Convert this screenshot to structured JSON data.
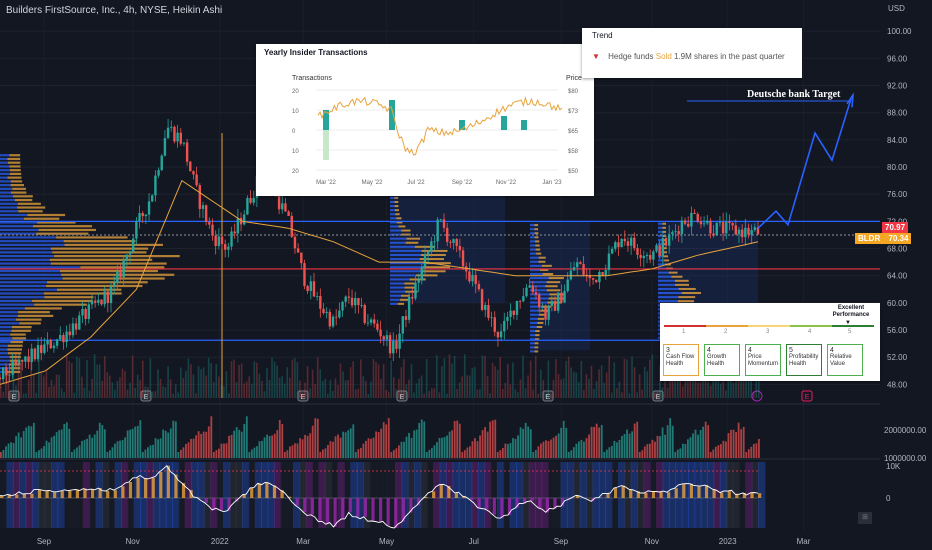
{
  "header": {
    "title": "Builders FirstSource, Inc., 4h, NYSE, Heikin Ashi"
  },
  "annotation": {
    "target_label": "Deutsche bank Target"
  },
  "price_tags": [
    {
      "ticker": "",
      "value": "70.97",
      "color": "#f23645"
    },
    {
      "ticker": "BLDR",
      "value": "70.34",
      "color": "#f5a623"
    }
  ],
  "icons": {
    "tv_logo": "tradingview-logo-icon",
    "earnings": "earnings-e-icon",
    "dividend": "dividend-icon"
  },
  "insider_panel": {
    "title": "Yearly Insider Transactions",
    "left_label": "Transactions",
    "right_label": "Price",
    "left_ticks": [
      "20",
      "10",
      "0",
      "10",
      "20"
    ],
    "right_ticks": [
      "$80",
      "$73",
      "$65",
      "$58",
      "$50"
    ],
    "x_ticks": [
      "Mar '22",
      "May '22",
      "Jul '22",
      "Sep '22",
      "Nov '22",
      "Jan '23"
    ]
  },
  "trend_panel": {
    "title": "Trend",
    "text_prefix": "Hedge funds ",
    "text_sold": "Sold",
    "text_suffix": " 1.9M shares in the past quarter"
  },
  "performance_panel": {
    "title": "Excellent Performance",
    "scale": [
      "1",
      "2",
      "3",
      "4",
      "5"
    ],
    "cards": [
      {
        "score": "3",
        "label": "Cash Flow Health"
      },
      {
        "score": "4",
        "label": "Growth Health"
      },
      {
        "score": "4",
        "label": "Price Momentum"
      },
      {
        "score": "5",
        "label": "Profitability Health"
      },
      {
        "score": "4",
        "label": "Relative Value"
      }
    ]
  },
  "chart_data": {
    "type": "candlestick",
    "title": "Builders FirstSource, Inc., 4h, NYSE, Heikin Ashi",
    "price_axis": {
      "unit": "USD",
      "ticks": [
        100,
        96,
        92,
        88,
        84,
        80,
        76,
        72,
        68,
        64,
        60,
        56,
        52,
        48
      ],
      "range": [
        46,
        104
      ]
    },
    "volume_axis": {
      "ticks": [
        "2000000.00",
        "1000000.00"
      ]
    },
    "osc_axis": {
      "ticks": [
        "10K",
        "0"
      ]
    },
    "x_ticks": [
      "Sep",
      "Nov",
      "2022",
      "Mar",
      "May",
      "Jul",
      "Sep",
      "Nov",
      "2023",
      "Mar"
    ],
    "horizontal_levels": [
      {
        "price": 72.0,
        "color": "#2962ff"
      },
      {
        "price": 70.0,
        "color": "#787b86"
      },
      {
        "price": 65.0,
        "color": "#f23645"
      },
      {
        "price": 54.5,
        "color": "#2962ff"
      }
    ],
    "projection": [
      71,
      73.5,
      71.5,
      85,
      81,
      90.5
    ],
    "target_price": 90.5,
    "last_price": 70.34,
    "high_price": 70.97,
    "price_path": [
      [
        0,
        49
      ],
      [
        0.04,
        52
      ],
      [
        0.08,
        55
      ],
      [
        0.12,
        59
      ],
      [
        0.15,
        62
      ],
      [
        0.18,
        71
      ],
      [
        0.2,
        76
      ],
      [
        0.22,
        86
      ],
      [
        0.24,
        84
      ],
      [
        0.26,
        76
      ],
      [
        0.28,
        70
      ],
      [
        0.3,
        68
      ],
      [
        0.32,
        73
      ],
      [
        0.34,
        78
      ],
      [
        0.36,
        77
      ],
      [
        0.38,
        72
      ],
      [
        0.4,
        64
      ],
      [
        0.42,
        60
      ],
      [
        0.44,
        57
      ],
      [
        0.46,
        61
      ],
      [
        0.48,
        58
      ],
      [
        0.5,
        56
      ],
      [
        0.52,
        53
      ],
      [
        0.54,
        60
      ],
      [
        0.56,
        66
      ],
      [
        0.58,
        72
      ],
      [
        0.6,
        68
      ],
      [
        0.62,
        64
      ],
      [
        0.64,
        59
      ],
      [
        0.66,
        55
      ],
      [
        0.68,
        60
      ],
      [
        0.7,
        63
      ],
      [
        0.72,
        58
      ],
      [
        0.74,
        61
      ],
      [
        0.76,
        66
      ],
      [
        0.78,
        63
      ],
      [
        0.8,
        66
      ],
      [
        0.82,
        70
      ],
      [
        0.84,
        68
      ],
      [
        0.86,
        67
      ],
      [
        0.88,
        69
      ],
      [
        0.9,
        72
      ],
      [
        0.92,
        73
      ],
      [
        0.94,
        71
      ],
      [
        1,
        70.34
      ]
    ],
    "ma_path": [
      [
        0,
        48
      ],
      [
        0.06,
        50
      ],
      [
        0.12,
        55
      ],
      [
        0.18,
        62
      ],
      [
        0.24,
        78
      ],
      [
        0.28,
        75
      ],
      [
        0.32,
        72
      ],
      [
        0.38,
        71
      ],
      [
        0.44,
        69
      ],
      [
        0.5,
        66
      ],
      [
        0.56,
        66
      ],
      [
        0.62,
        65
      ],
      [
        0.68,
        64
      ],
      [
        0.74,
        64
      ],
      [
        0.8,
        64
      ],
      [
        0.86,
        65
      ],
      [
        0.92,
        67
      ],
      [
        1,
        69
      ]
    ]
  }
}
